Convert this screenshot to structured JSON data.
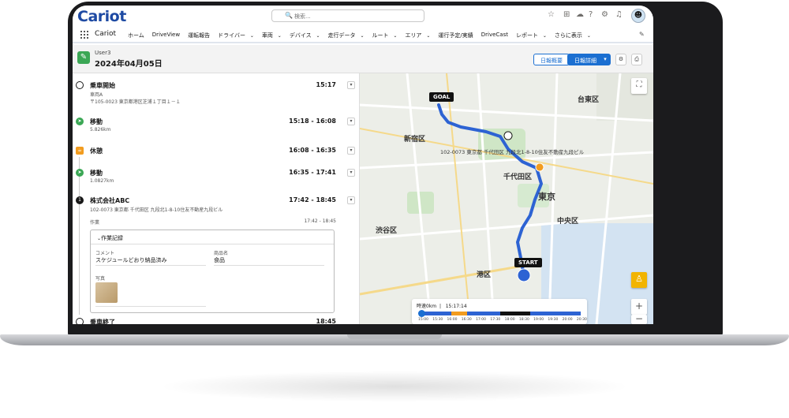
{
  "app": {
    "logo": "Cariot",
    "name": "Cariot"
  },
  "search": {
    "placeholder": "検索..."
  },
  "nav": {
    "items": [
      {
        "label": "ホーム",
        "dropdown": false
      },
      {
        "label": "DriveView",
        "dropdown": false
      },
      {
        "label": "運転報告",
        "dropdown": false
      },
      {
        "label": "ドライバー",
        "dropdown": true
      },
      {
        "label": "車両",
        "dropdown": true
      },
      {
        "label": "デバイス",
        "dropdown": true
      },
      {
        "label": "走行データ",
        "dropdown": true
      },
      {
        "label": "ルート",
        "dropdown": true
      },
      {
        "label": "エリア",
        "dropdown": true
      },
      {
        "label": "運行予定/実績",
        "dropdown": false
      },
      {
        "label": "DriveCast",
        "dropdown": false
      },
      {
        "label": "レポート",
        "dropdown": true
      },
      {
        "label": "さらに表示",
        "dropdown": true
      }
    ]
  },
  "header": {
    "user": "User3",
    "date": "2024年04月05日",
    "btn_summary": "日報概要",
    "btn_detail": "日報詳細"
  },
  "timeline": {
    "items": [
      {
        "title": "乗車開始",
        "time": "15:17",
        "sub1": "車両A",
        "sub2": "〒105-0023 東京都港区芝浦１丁目１－１"
      },
      {
        "title": "移動",
        "time": "15:18 - 16:08",
        "sub1": "5.826km"
      },
      {
        "title": "休憩",
        "time": "16:08 - 16:35"
      },
      {
        "title": "移動",
        "time": "16:35 - 17:41",
        "sub1": "1.0827km"
      },
      {
        "title": "株式会社ABC",
        "time": "17:42 - 18:45",
        "sub1": "102-0073 東京都 千代田区 九段北1-8-10住友不動産九段ビル",
        "num": "1"
      },
      {
        "title": "乗車終了",
        "time": "18:45"
      }
    ],
    "task": {
      "label": "作業",
      "time": "17:42 - 18:45"
    },
    "card": {
      "title": "作業記録",
      "comment_label": "コメント",
      "comment_value": "スケジュールどおり納品済み",
      "product_label": "商品名",
      "product_value": "食品",
      "photo_label": "写真"
    }
  },
  "map": {
    "goal": "GOAL",
    "start": "START",
    "address": "102-0073 東京都 千代田区 九段北1-8-10住友不動産九段ビル",
    "labels": {
      "shinjuku": "新宿区",
      "taito": "台東区",
      "chiyoda": "千代田区",
      "tokyo": "東京",
      "chuo": "中央区",
      "shibuya": "渋谷区",
      "minato": "港区"
    },
    "time_panel": {
      "label": "時速0km",
      "time": "15:17:14",
      "ticks": [
        "15:00",
        "15:30",
        "16:00",
        "16:30",
        "17:00",
        "17:30",
        "18:00",
        "18:30",
        "19:00",
        "19:30",
        "20:00",
        "20:30"
      ]
    }
  }
}
